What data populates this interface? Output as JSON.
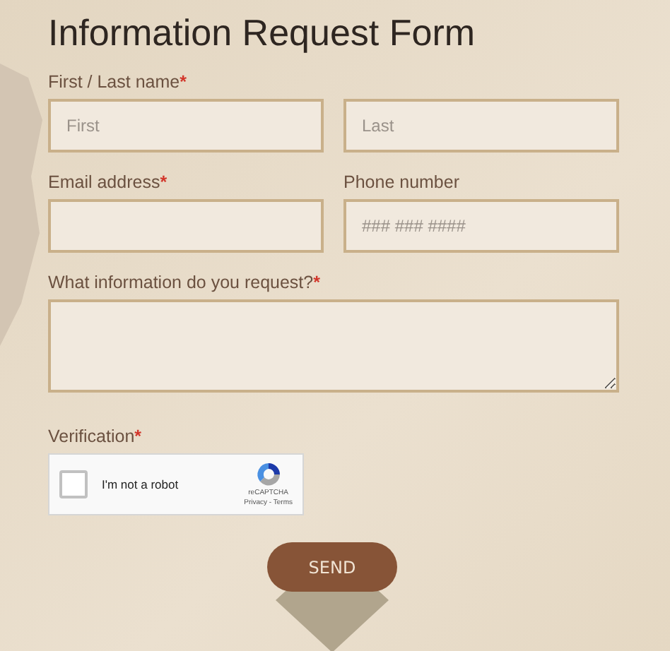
{
  "title": "Information Request Form",
  "rows": [
    {
      "fields": [
        {
          "label": "First / Last name",
          "required_mark": "*",
          "inputs": [
            {
              "kind": "text",
              "placeholder": "First"
            },
            {
              "kind": "text",
              "placeholder": "Last"
            }
          ]
        }
      ]
    },
    {
      "fields": [
        {
          "label": "Email address",
          "required_mark": "*",
          "inputs": [
            {
              "kind": "text"
            }
          ]
        },
        {
          "label": "Phone number",
          "inputs": [
            {
              "kind": "text",
              "placeholder": "### ### ####"
            }
          ]
        }
      ]
    },
    {
      "fields": [
        {
          "label": "What information do you request?",
          "required_mark": "*",
          "inputs": [
            {
              "kind": "textarea"
            }
          ]
        }
      ]
    }
  ],
  "verification": {
    "label": "Verification",
    "required_mark": "*",
    "captcha": {
      "checked": false,
      "text": "I'm not a robot",
      "brand": "reCAPTCHA",
      "links": "Privacy - Terms"
    }
  },
  "submit": "SEND"
}
